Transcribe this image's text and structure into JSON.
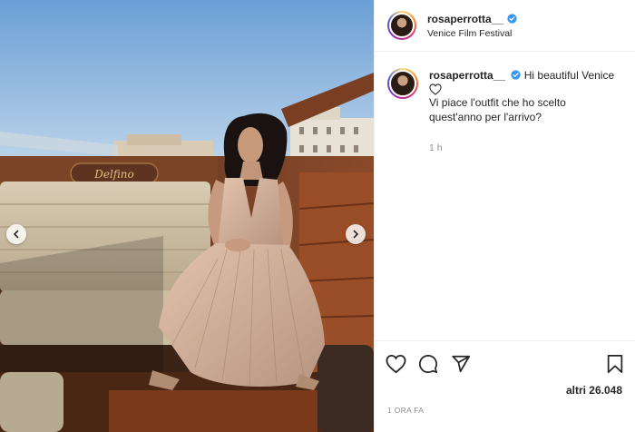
{
  "post": {
    "username": "rosaperrotta__",
    "location": "Venice Film Festival",
    "caption_greeting": "Hi beautiful Venice",
    "caption_body": "Vi piace l'outfit che ho scelto quest'anno per l'arrivo?",
    "comment_time": "1 h",
    "likes_text": "altri 26.048",
    "date_text": "1 ORA FA"
  },
  "boat_text": "Delfino",
  "icons": {
    "verified": "verified-badge-icon",
    "heart": "heart-icon",
    "comment": "comment-icon",
    "share": "paper-plane-icon",
    "save": "bookmark-icon",
    "prev": "chevron-left-icon",
    "next": "chevron-right-icon"
  },
  "colors": {
    "verified_blue": "#3897f0",
    "text": "#262626",
    "muted": "#8e8e8e"
  }
}
